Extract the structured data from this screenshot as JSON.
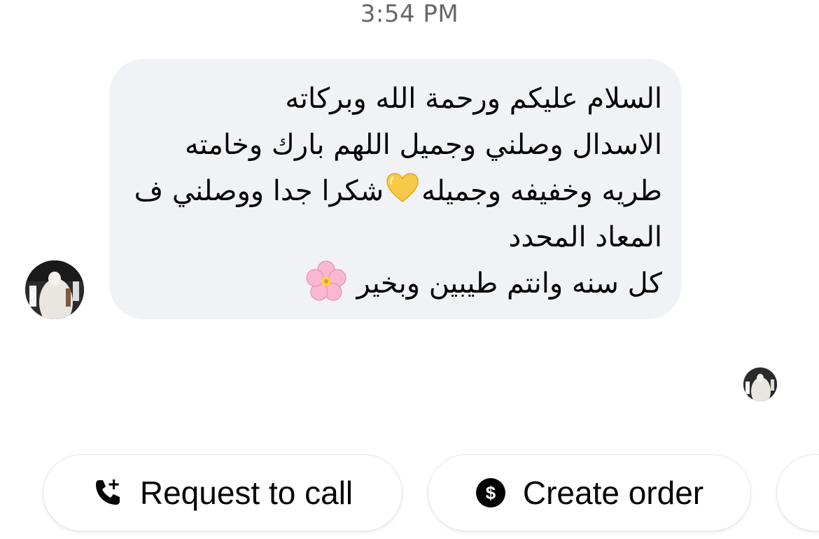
{
  "timestamp": "3:54 PM",
  "message": {
    "line1": "السلام عليكم ورحمة الله وبركاته",
    "line2": "الاسدال وصلني وجميل اللهم بارك وخامته",
    "line3_before_heart": "طريه وخفيفه وجميله",
    "line3_heart": "yellow-heart-emoji",
    "line3_after_heart": "شكرا جدا ووصلني ف",
    "line4": "المعاد المحدد",
    "line5": "كل سنه وانتم طيبين وبخير",
    "line5_emoji": "cherry-blossom-emoji"
  },
  "actions": {
    "request_call_label": "Request to call",
    "request_call_icon": "phone-plus-icon",
    "create_order_label": "Create order",
    "create_order_icon": "dollar-circle-icon"
  },
  "colors": {
    "bubble_bg": "#f0f2f5",
    "timestamp": "#65676b",
    "text": "#050505",
    "heart": "#f7c948",
    "blossom": "#f7a8c8"
  }
}
